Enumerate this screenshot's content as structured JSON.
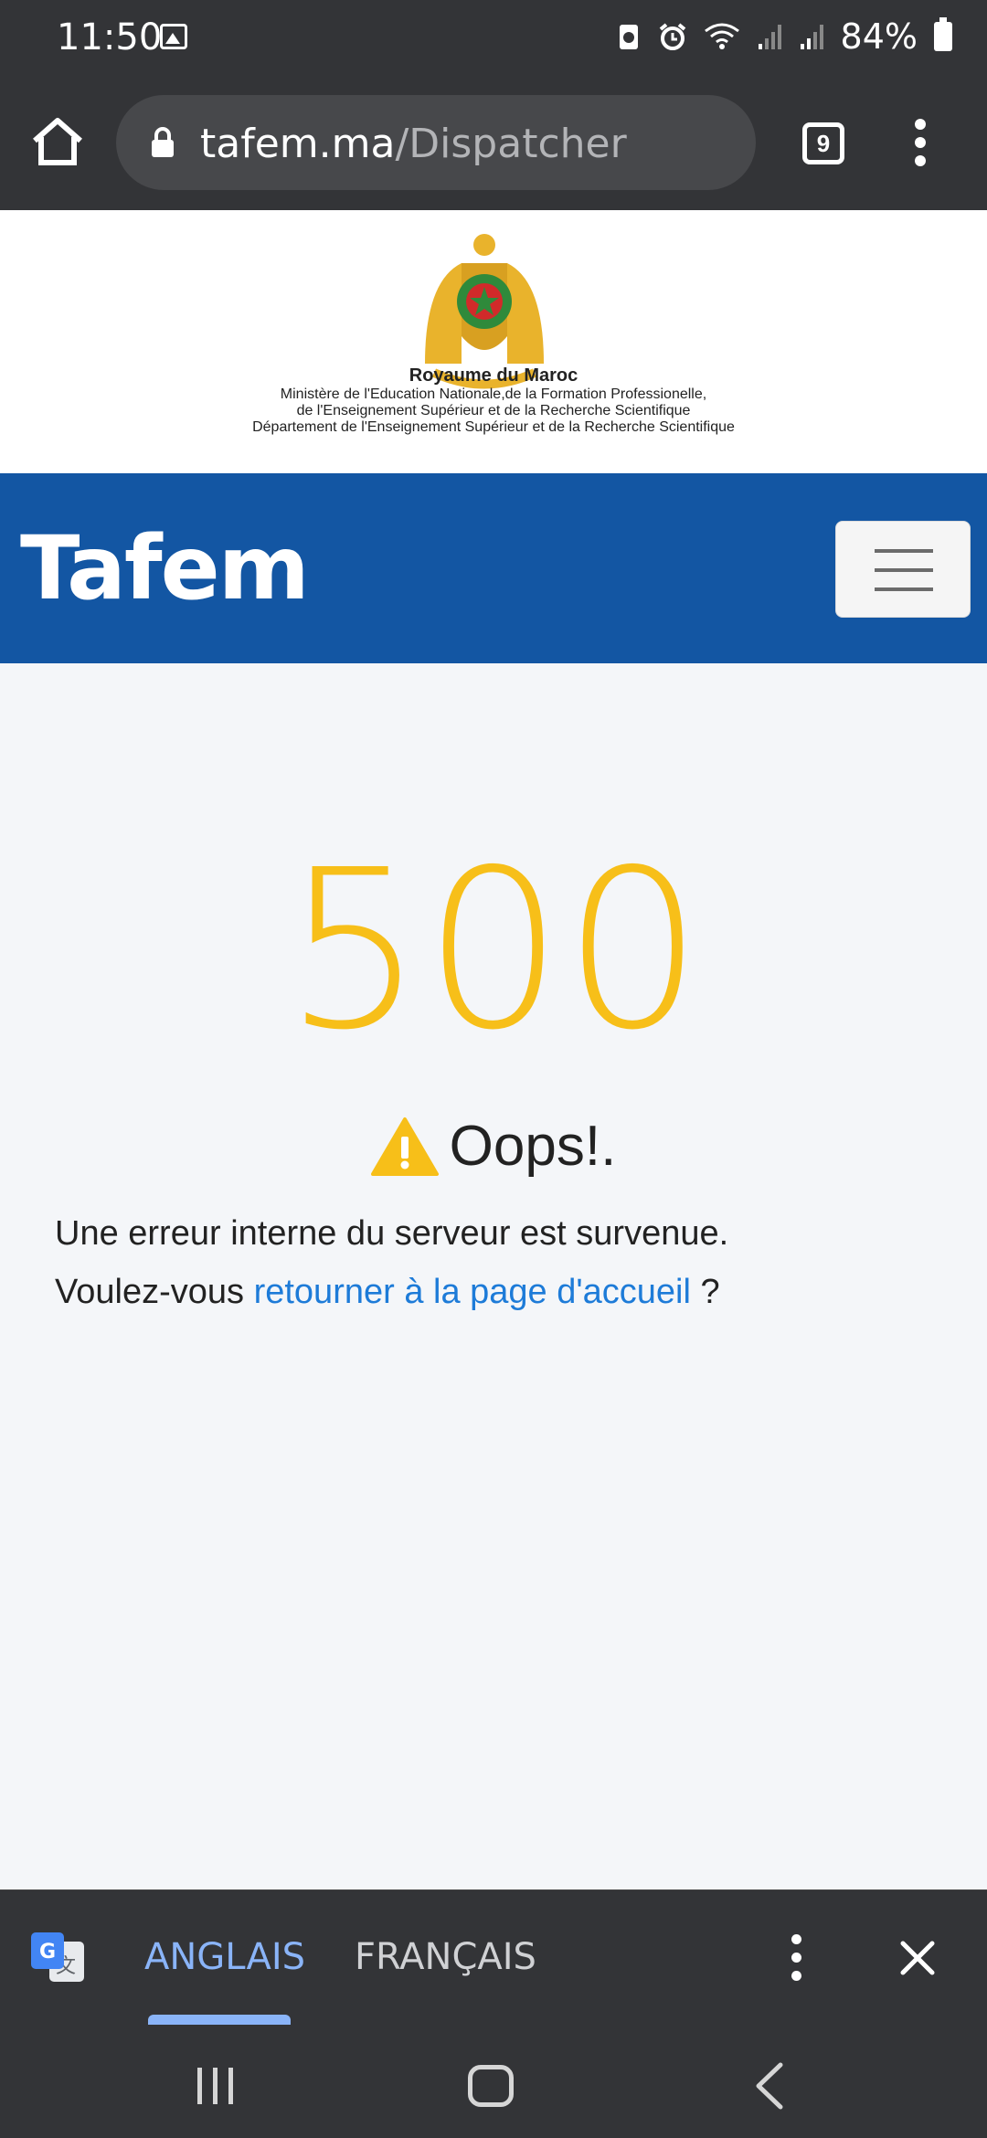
{
  "status_bar": {
    "time": "11:50",
    "battery_percent": "84%",
    "icons": [
      "image-icon",
      "data-saver-icon",
      "alarm-icon",
      "wifi-icon",
      "signal-icon",
      "signal-icon",
      "battery-icon"
    ]
  },
  "browser": {
    "url_host": "tafem.ma",
    "url_path": "/Dispatcher",
    "tab_count": "9"
  },
  "header": {
    "line1": "Royaume du Maroc",
    "line2": "Ministère de l'Education Nationale,de la Formation Professionelle,",
    "line3": "de l'Enseignement Supérieur et de la Recherche Scientifique",
    "line4": "Département de l'Enseignement Supérieur et de la Recherche Scientifique"
  },
  "navbar": {
    "brand": "Tafem"
  },
  "error": {
    "code": "500",
    "title": "Oops!.",
    "message": "Une erreur interne du serveur est survenue.",
    "prompt_before": "Voulez-vous ",
    "link_text": "retourner à la page d'accueil",
    "prompt_after": " ?"
  },
  "translate_bar": {
    "active_language": "ANGLAIS",
    "inactive_language": "FRANÇAIS"
  },
  "colors": {
    "status_bg": "#333437",
    "navbar_bg": "#1356a3",
    "error_code": "#f7bf19",
    "link": "#1d7bd8",
    "translate_active": "#8ab4f8"
  }
}
